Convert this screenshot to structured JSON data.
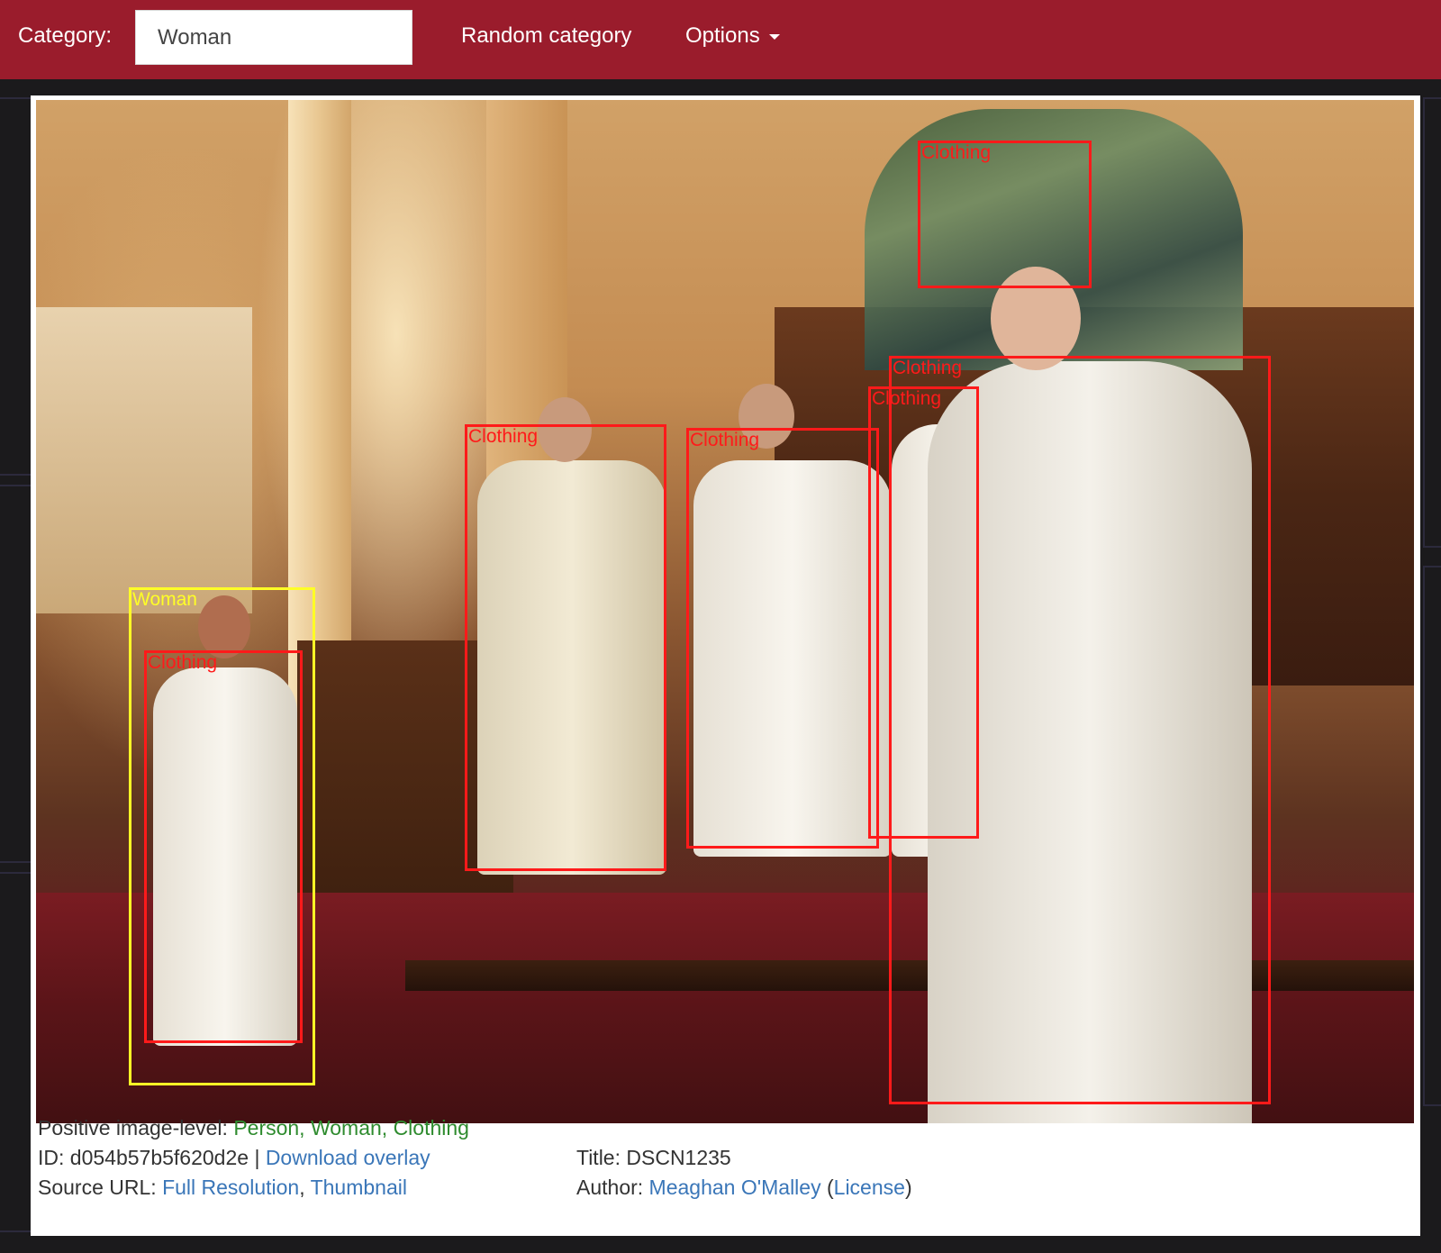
{
  "navbar": {
    "category_label": "Category:",
    "category_value": "Woman",
    "random_label": "Random category",
    "options_label": "Options",
    "background_color": "#9a1c2c"
  },
  "annotations": [
    {
      "label": "Clothing",
      "color": "red"
    },
    {
      "label": "Clothing",
      "color": "red"
    },
    {
      "label": "Clothing",
      "color": "red"
    },
    {
      "label": "Clothing",
      "color": "red"
    },
    {
      "label": "Clothing",
      "color": "red"
    },
    {
      "label": "Woman",
      "color": "yellow"
    },
    {
      "label": "Clothing",
      "color": "red"
    }
  ],
  "info": {
    "positive_label": "Positive image-level:",
    "positive_values": "Person, Woman, Clothing",
    "id_label": "ID:",
    "id_value": "d054b57b5f620d2e",
    "separator": "|",
    "download_label": "Download overlay",
    "source_label": "Source URL:",
    "full_res_label": "Full Resolution",
    "comma": ",",
    "thumbnail_label": "Thumbnail",
    "title_label": "Title:",
    "title_value": "DSCN1235",
    "author_label": "Author:",
    "author_name": "Meaghan O'Malley",
    "paren_open": "(",
    "license_label": "License",
    "paren_close": ")"
  },
  "colors": {
    "box_red": "#ff1a1a",
    "box_yellow": "#ffff26",
    "positive_green": "#2e8b2e",
    "link_blue": "#3a76b8"
  }
}
